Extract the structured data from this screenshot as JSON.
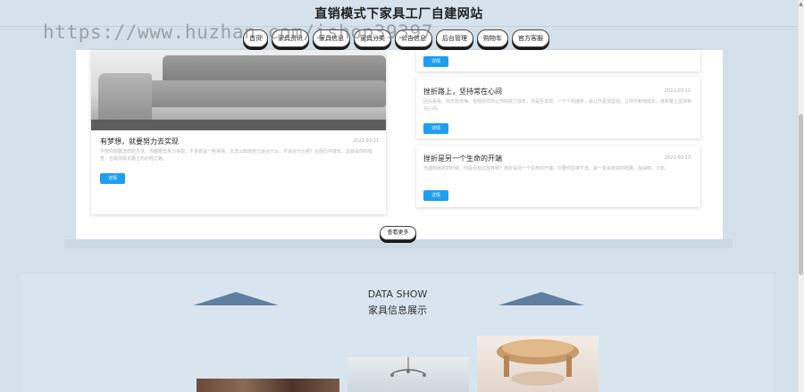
{
  "header": {
    "title": "直销模式下家具工厂自建网站"
  },
  "watermark": "https://www.huzhan.com/ishop39397",
  "nav": {
    "items": [
      {
        "label": "首页"
      },
      {
        "label": "家具资讯"
      },
      {
        "label": "家具信息"
      },
      {
        "label": "家具分类"
      },
      {
        "label": "公告信息"
      },
      {
        "label": "后台管理"
      },
      {
        "label": "购物车"
      },
      {
        "label": "官方客服"
      }
    ]
  },
  "articles": {
    "left": {
      "title": "有梦想，就要努力去实现",
      "date": "2021-03-11",
      "excerpt": "不管你想要怎样的生活，你都要去努力争取，不多尝试一些事情，又怎么知道自己适合什么，不适合什么呢？在经历中成长，这就是你的标签，也是你成长路上的必经之路。",
      "button": "详情"
    },
    "top_button": "详情",
    "right": [
      {
        "title": "挫折路上，坚持常在心间",
        "date": "2021-03-12",
        "excerpt": "回头看看，你无怨无悔，曾经的付出让你收获了成长，你是否发现，一个个的挫折，会让你更加坚强，让你不断地成长，挫折路上坚持常在心间。",
        "button": "详情"
      },
      {
        "title": "挫折是另一个生命的开端",
        "date": "2021-03-13",
        "excerpt": "当遇到挫折的时候，你是否想过放弃呢？挫折是另一个生命的开端，只要你坚持下去，就一定会有好的结果，加油吧，少年。",
        "button": "详情"
      }
    ],
    "more_button": "查看更多"
  },
  "data_show": {
    "title": "DATA SHOW",
    "subtitle": "家具信息展示"
  },
  "colors": {
    "page_bg": "#d3e0ea",
    "accent_button": "#1d9ff0",
    "triangle": "#5e7fa2"
  }
}
